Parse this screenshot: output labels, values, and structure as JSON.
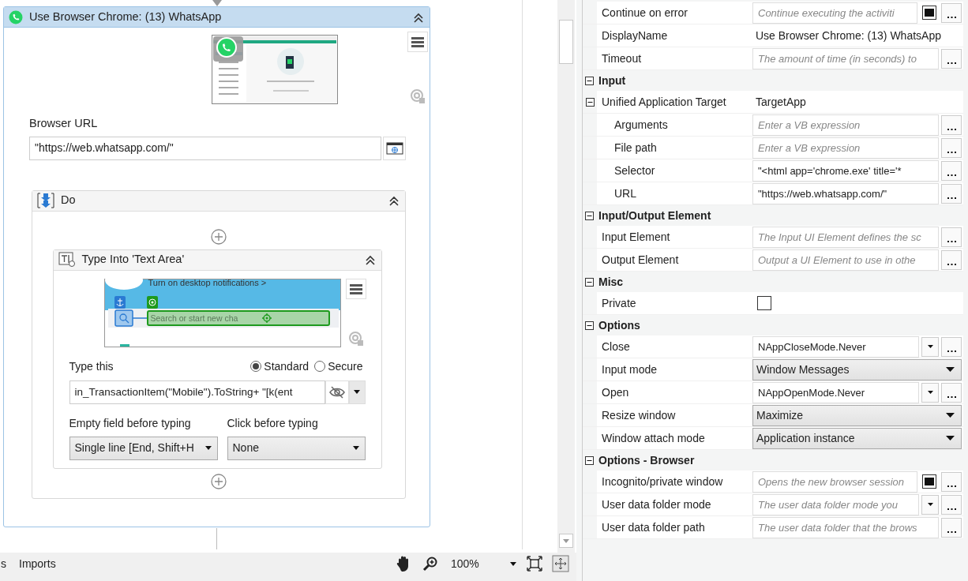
{
  "designer": {
    "activity": {
      "title": "Use Browser Chrome: (13) WhatsApp",
      "expanded": true,
      "url_label": "Browser URL",
      "url_value": "\"https://web.whatsapp.com/\"",
      "sequence": {
        "title": "Do",
        "expanded": true,
        "activities": [
          {
            "title": "Type Into 'Text Area'",
            "expanded": true,
            "preview": {
              "banner_text": "Turn on desktop notifications >",
              "search_text": "Search or start new cha"
            },
            "type_label": "Type this",
            "modes": [
              {
                "label": "Standard",
                "selected": true
              },
              {
                "label": "Secure",
                "selected": false
              }
            ],
            "type_value": "in_TransactionItem(\"Mobile\").ToString+ \"[k(ent",
            "empty_field": {
              "label": "Empty field before typing",
              "value": "Single line [End, Shift+H"
            },
            "click": {
              "label": "Click before typing",
              "value": "None"
            }
          }
        ]
      }
    }
  },
  "status_bar": {
    "tabs": [
      "s",
      "Imports"
    ],
    "zoom": "100%"
  },
  "properties": {
    "sections": [
      {
        "rows": [
          {
            "label": "Continue on error",
            "kind": "input-check",
            "placeholder": "Continue executing the activiti",
            "checked": true
          },
          {
            "label": "DisplayName",
            "kind": "text",
            "value": "Use Browser Chrome: (13) WhatsApp"
          },
          {
            "label": "Timeout",
            "kind": "input",
            "placeholder": "The amount of time (in seconds) to"
          }
        ]
      },
      {
        "name": "Input",
        "expanded": true,
        "rows": [
          {
            "label": "Unified Application Target",
            "kind": "text",
            "value": "TargetApp",
            "expanded": true,
            "children": [
              {
                "label": "Arguments",
                "kind": "input",
                "placeholder": "Enter a VB expression"
              },
              {
                "label": "File path",
                "kind": "input",
                "placeholder": "Enter a VB expression"
              },
              {
                "label": "Selector",
                "kind": "input",
                "value": "\"<html app='chrome.exe' title='*"
              },
              {
                "label": "URL",
                "kind": "input",
                "value": "\"https://web.whatsapp.com/\""
              }
            ]
          }
        ]
      },
      {
        "name": "Input/Output Element",
        "expanded": true,
        "rows": [
          {
            "label": "Input Element",
            "kind": "input",
            "placeholder": "The Input UI Element defines the sc"
          },
          {
            "label": "Output Element",
            "kind": "input",
            "placeholder": "Output a UI Element to use in othe"
          }
        ]
      },
      {
        "name": "Misc",
        "expanded": true,
        "rows": [
          {
            "label": "Private",
            "kind": "checkbox",
            "checked": false
          }
        ]
      },
      {
        "name": "Options",
        "expanded": true,
        "rows": [
          {
            "label": "Close",
            "kind": "combo",
            "value": "NAppCloseMode.Never"
          },
          {
            "label": "Input mode",
            "kind": "select",
            "value": "Window Messages"
          },
          {
            "label": "Open",
            "kind": "combo",
            "value": "NAppOpenMode.Never"
          },
          {
            "label": "Resize window",
            "kind": "select",
            "value": "Maximize"
          },
          {
            "label": "Window attach mode",
            "kind": "select",
            "value": "Application instance"
          }
        ]
      },
      {
        "name": "Options - Browser",
        "expanded": true,
        "rows": [
          {
            "label": "Incognito/private window",
            "kind": "input-check",
            "placeholder": "Opens the new browser session",
            "checked": true
          },
          {
            "label": "User data folder mode",
            "kind": "combo",
            "placeholder": "The user data folder mode you"
          },
          {
            "label": "User data folder path",
            "kind": "input",
            "placeholder": "The user data folder that the brows"
          }
        ]
      }
    ]
  }
}
